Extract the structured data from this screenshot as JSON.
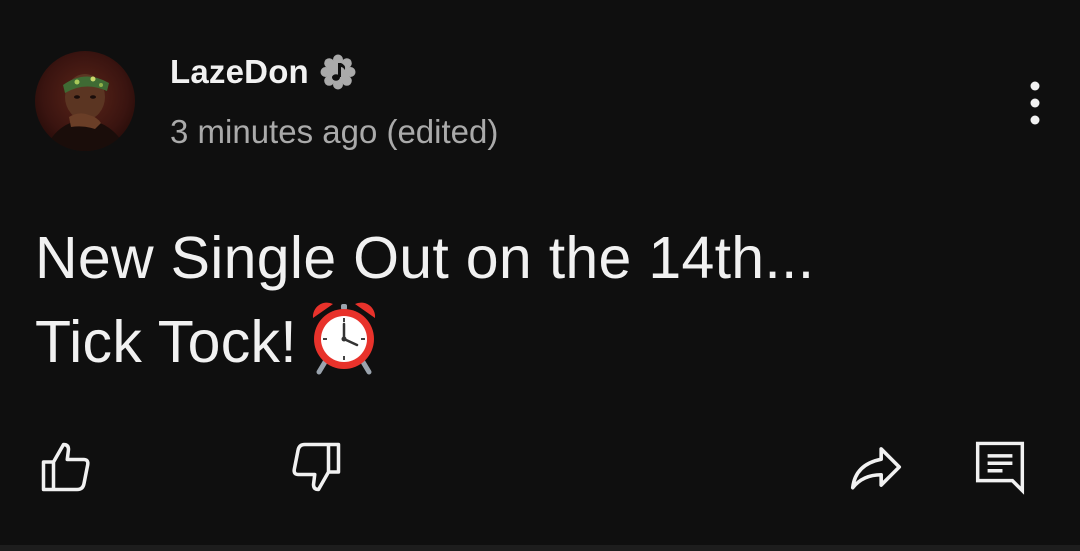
{
  "post": {
    "author": "LazeDon",
    "badge_icon": "music-note-badge-icon",
    "timestamp": "3 minutes ago (edited)",
    "text_line1": "New Single Out on the 14th...",
    "text_line2": "Tick Tock!",
    "emoji_icon": "alarm-clock-emoji"
  },
  "actions": {
    "like_icon": "thumb-up-icon",
    "dislike_icon": "thumb-down-icon",
    "share_icon": "share-icon",
    "comment_icon": "comment-icon",
    "more_icon": "more-vert-icon"
  },
  "colors": {
    "background": "#0f0f0f",
    "text_primary": "#f1f1f1",
    "text_secondary": "#aaaaaa",
    "alarm_red": "#e8322b"
  }
}
